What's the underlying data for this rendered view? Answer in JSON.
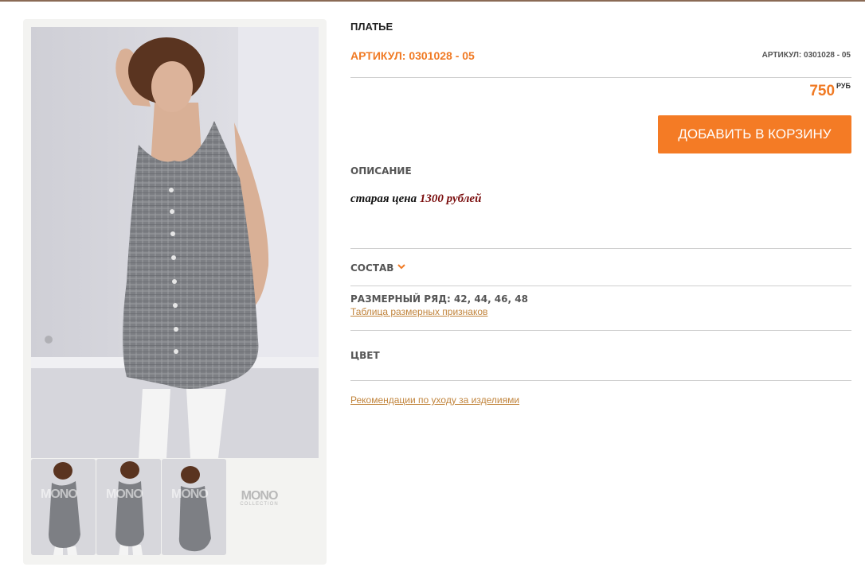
{
  "product": {
    "title": "ПЛАТЬЕ",
    "sku_label": "АРТИКУЛ: 0301028 - 05",
    "sku_small": "АРТИКУЛ: 0301028 - 05",
    "price": "750",
    "currency": "РУБ",
    "add_to_cart": "ДОБАВИТЬ В КОРЗИНУ"
  },
  "description": {
    "heading": "ОПИСАНИЕ",
    "old_price_text": "старая цена",
    "old_price_amount": "1300 рублей"
  },
  "composition": {
    "heading": "СОСТАВ"
  },
  "sizes": {
    "label": "РАЗМЕРНЫЙ РЯД: 42, 44, 46, 48",
    "table_link": "Таблица размерных признаков"
  },
  "color": {
    "heading": "ЦВЕТ"
  },
  "care_link": "Рекомендации по уходу за изделиями",
  "gallery": {
    "watermark": "MONO",
    "logo": "MONO",
    "logo_sub": "COLLECTION"
  },
  "colors": {
    "accent": "#f47b25",
    "old_price": "#7a0d0d",
    "link": "#c1843c"
  }
}
